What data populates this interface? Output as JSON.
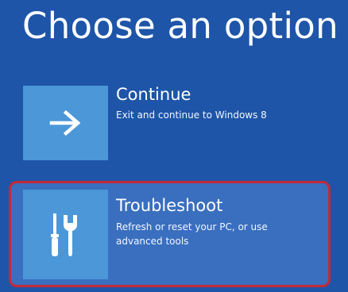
{
  "title": "Choose an option",
  "options": [
    {
      "label": "Continue",
      "description": "Exit and continue to Windows 8",
      "icon": "arrow-right-icon"
    },
    {
      "label": "Troubleshoot",
      "description": "Refresh or reset your PC, or use advanced tools",
      "icon": "tools-icon",
      "highlighted": true
    }
  ],
  "colors": {
    "background": "#1e55a8",
    "tile": "#4b97d8",
    "highlight_fill": "#3a6fbf",
    "highlight_border": "#c22a3a"
  }
}
